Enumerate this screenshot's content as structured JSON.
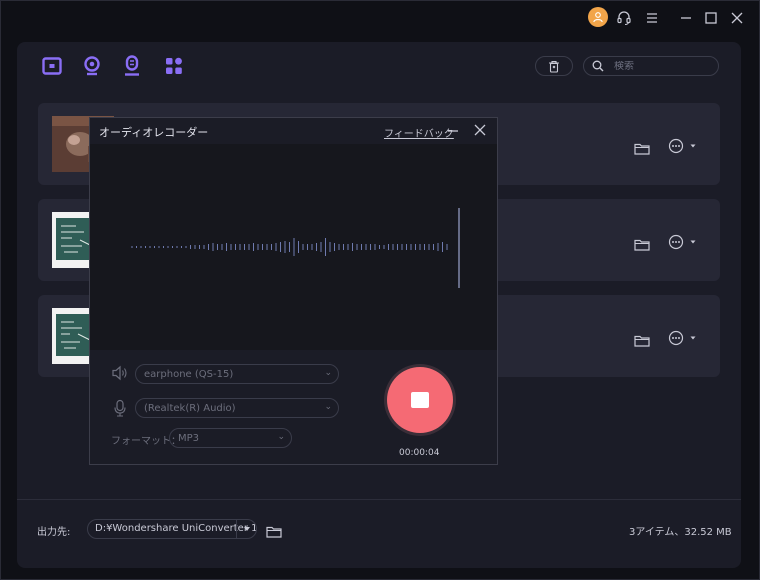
{
  "colors": {
    "accent": "#8a6ef5",
    "record": "#f56a74",
    "avatar": "#f2a54a"
  },
  "titlebar": {
    "icons": [
      "user-avatar-icon",
      "headset-icon",
      "menu-icon",
      "minimize-icon",
      "maximize-icon",
      "close-icon"
    ]
  },
  "toolbar": {
    "tools": [
      "screen-record-icon",
      "webcam-icon",
      "audio-record-icon",
      "apps-icon"
    ],
    "search_placeholder": "検索"
  },
  "rows": [
    {
      "thumbnail": "photo",
      "actions": [
        "folder-icon",
        "more-icon"
      ]
    },
    {
      "thumbnail": "blackboard",
      "actions": [
        "folder-icon",
        "more-icon"
      ]
    },
    {
      "thumbnail": "blackboard",
      "actions": [
        "folder-icon",
        "more-icon"
      ]
    }
  ],
  "recorder": {
    "title": "オーディオレコーダー",
    "feedback": "フィードバック",
    "speaker": "earphone (QS-15)",
    "microphone": "(Realtek(R) Audio)",
    "format_label": "フォーマット：",
    "format": "MP3",
    "timer": "00:00:04"
  },
  "footer": {
    "output_label": "出力先:",
    "output_path": "D:¥Wondershare UniConverter 1",
    "summary": "3アイテム、32.52 MB"
  }
}
